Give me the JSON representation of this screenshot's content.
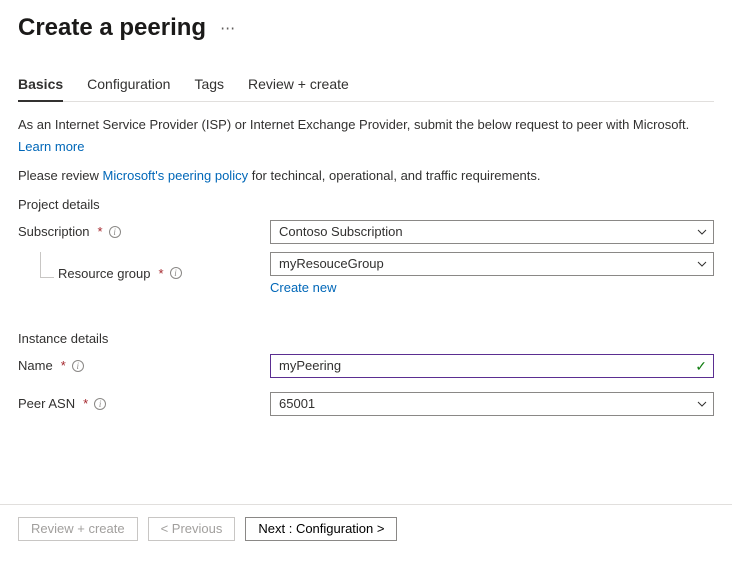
{
  "header": {
    "title": "Create a peering"
  },
  "tabs": [
    {
      "label": "Basics",
      "active": true
    },
    {
      "label": "Configuration",
      "active": false
    },
    {
      "label": "Tags",
      "active": false
    },
    {
      "label": "Review + create",
      "active": false
    }
  ],
  "intro": {
    "text": "As an Internet Service Provider (ISP) or Internet Exchange Provider, submit the below request to peer with Microsoft.",
    "learn_more": "Learn more"
  },
  "policy": {
    "prefix": "Please review ",
    "link": "Microsoft's peering policy",
    "suffix": " for techincal, operational, and traffic requirements."
  },
  "sections": {
    "project": {
      "title": "Project details",
      "subscription_label": "Subscription",
      "subscription_value": "Contoso Subscription",
      "resource_group_label": "Resource group",
      "resource_group_value": "myResouceGroup",
      "create_new": "Create new"
    },
    "instance": {
      "title": "Instance details",
      "name_label": "Name",
      "name_value": "myPeering",
      "asn_label": "Peer ASN",
      "asn_value": "65001"
    }
  },
  "buttons": {
    "review": "Review + create",
    "previous": "< Previous",
    "next": "Next : Configuration >"
  }
}
